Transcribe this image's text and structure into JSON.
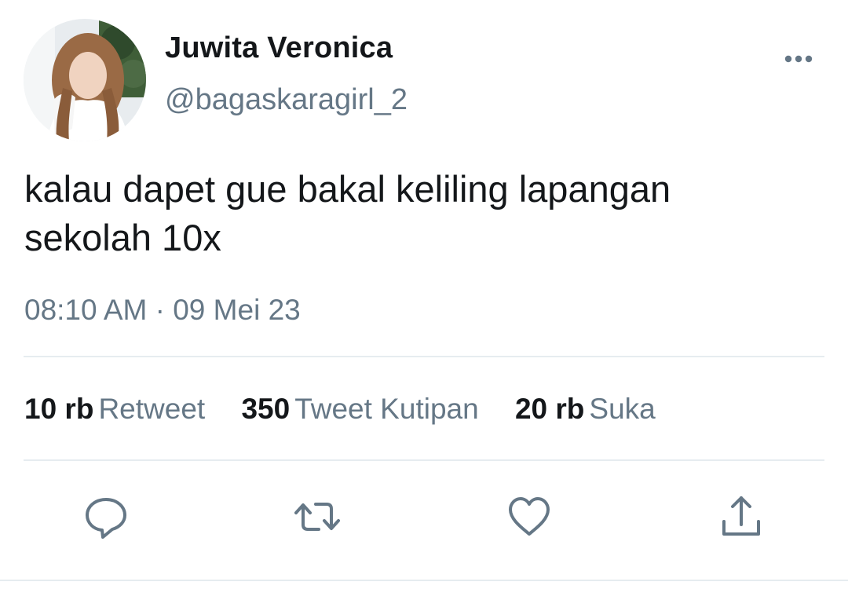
{
  "tweet": {
    "author": {
      "display_name": "Juwita Veronica",
      "handle": "@bagaskaragirl_2"
    },
    "text_line_1": "kalau dapet gue bakal keliling lapangan",
    "text_line_2": "sekolah 10x",
    "time": "08:10 AM",
    "separator": "·",
    "date": "09 Mei 23"
  },
  "stats": {
    "retweets": {
      "count": "10 rb",
      "label": "Retweet"
    },
    "quotes": {
      "count": "350",
      "label": "Tweet Kutipan"
    },
    "likes": {
      "count": "20 rb",
      "label": "Suka"
    }
  },
  "icons": {
    "more": "more-horizontal-icon",
    "reply": "reply-icon",
    "retweet": "retweet-icon",
    "like": "heart-icon",
    "share": "share-icon"
  },
  "colors": {
    "primary_text": "#14171a",
    "secondary_text": "#657786",
    "icon": "#657786",
    "divider": "#e6ecf0"
  }
}
